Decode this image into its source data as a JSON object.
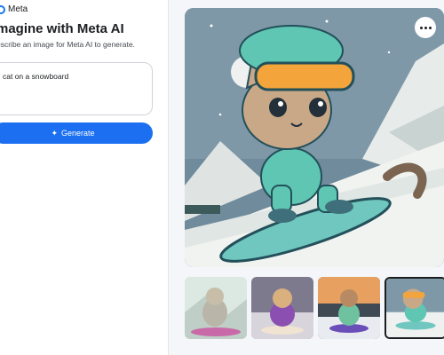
{
  "brand": {
    "name": "Meta"
  },
  "heading": {
    "title": "magine with Meta AI",
    "subtitle": "escribe an image for Meta AI to generate."
  },
  "prompt": {
    "value": "cat on a snowboard"
  },
  "generate": {
    "label": "Generate"
  },
  "colors": {
    "accent": "#1b6ff0"
  },
  "icons": {
    "more": "more-icon",
    "sparkle": "sparkle-icon",
    "logo": "meta-logo-icon"
  },
  "thumbnails": {
    "count": 4,
    "selected_index": 3
  }
}
